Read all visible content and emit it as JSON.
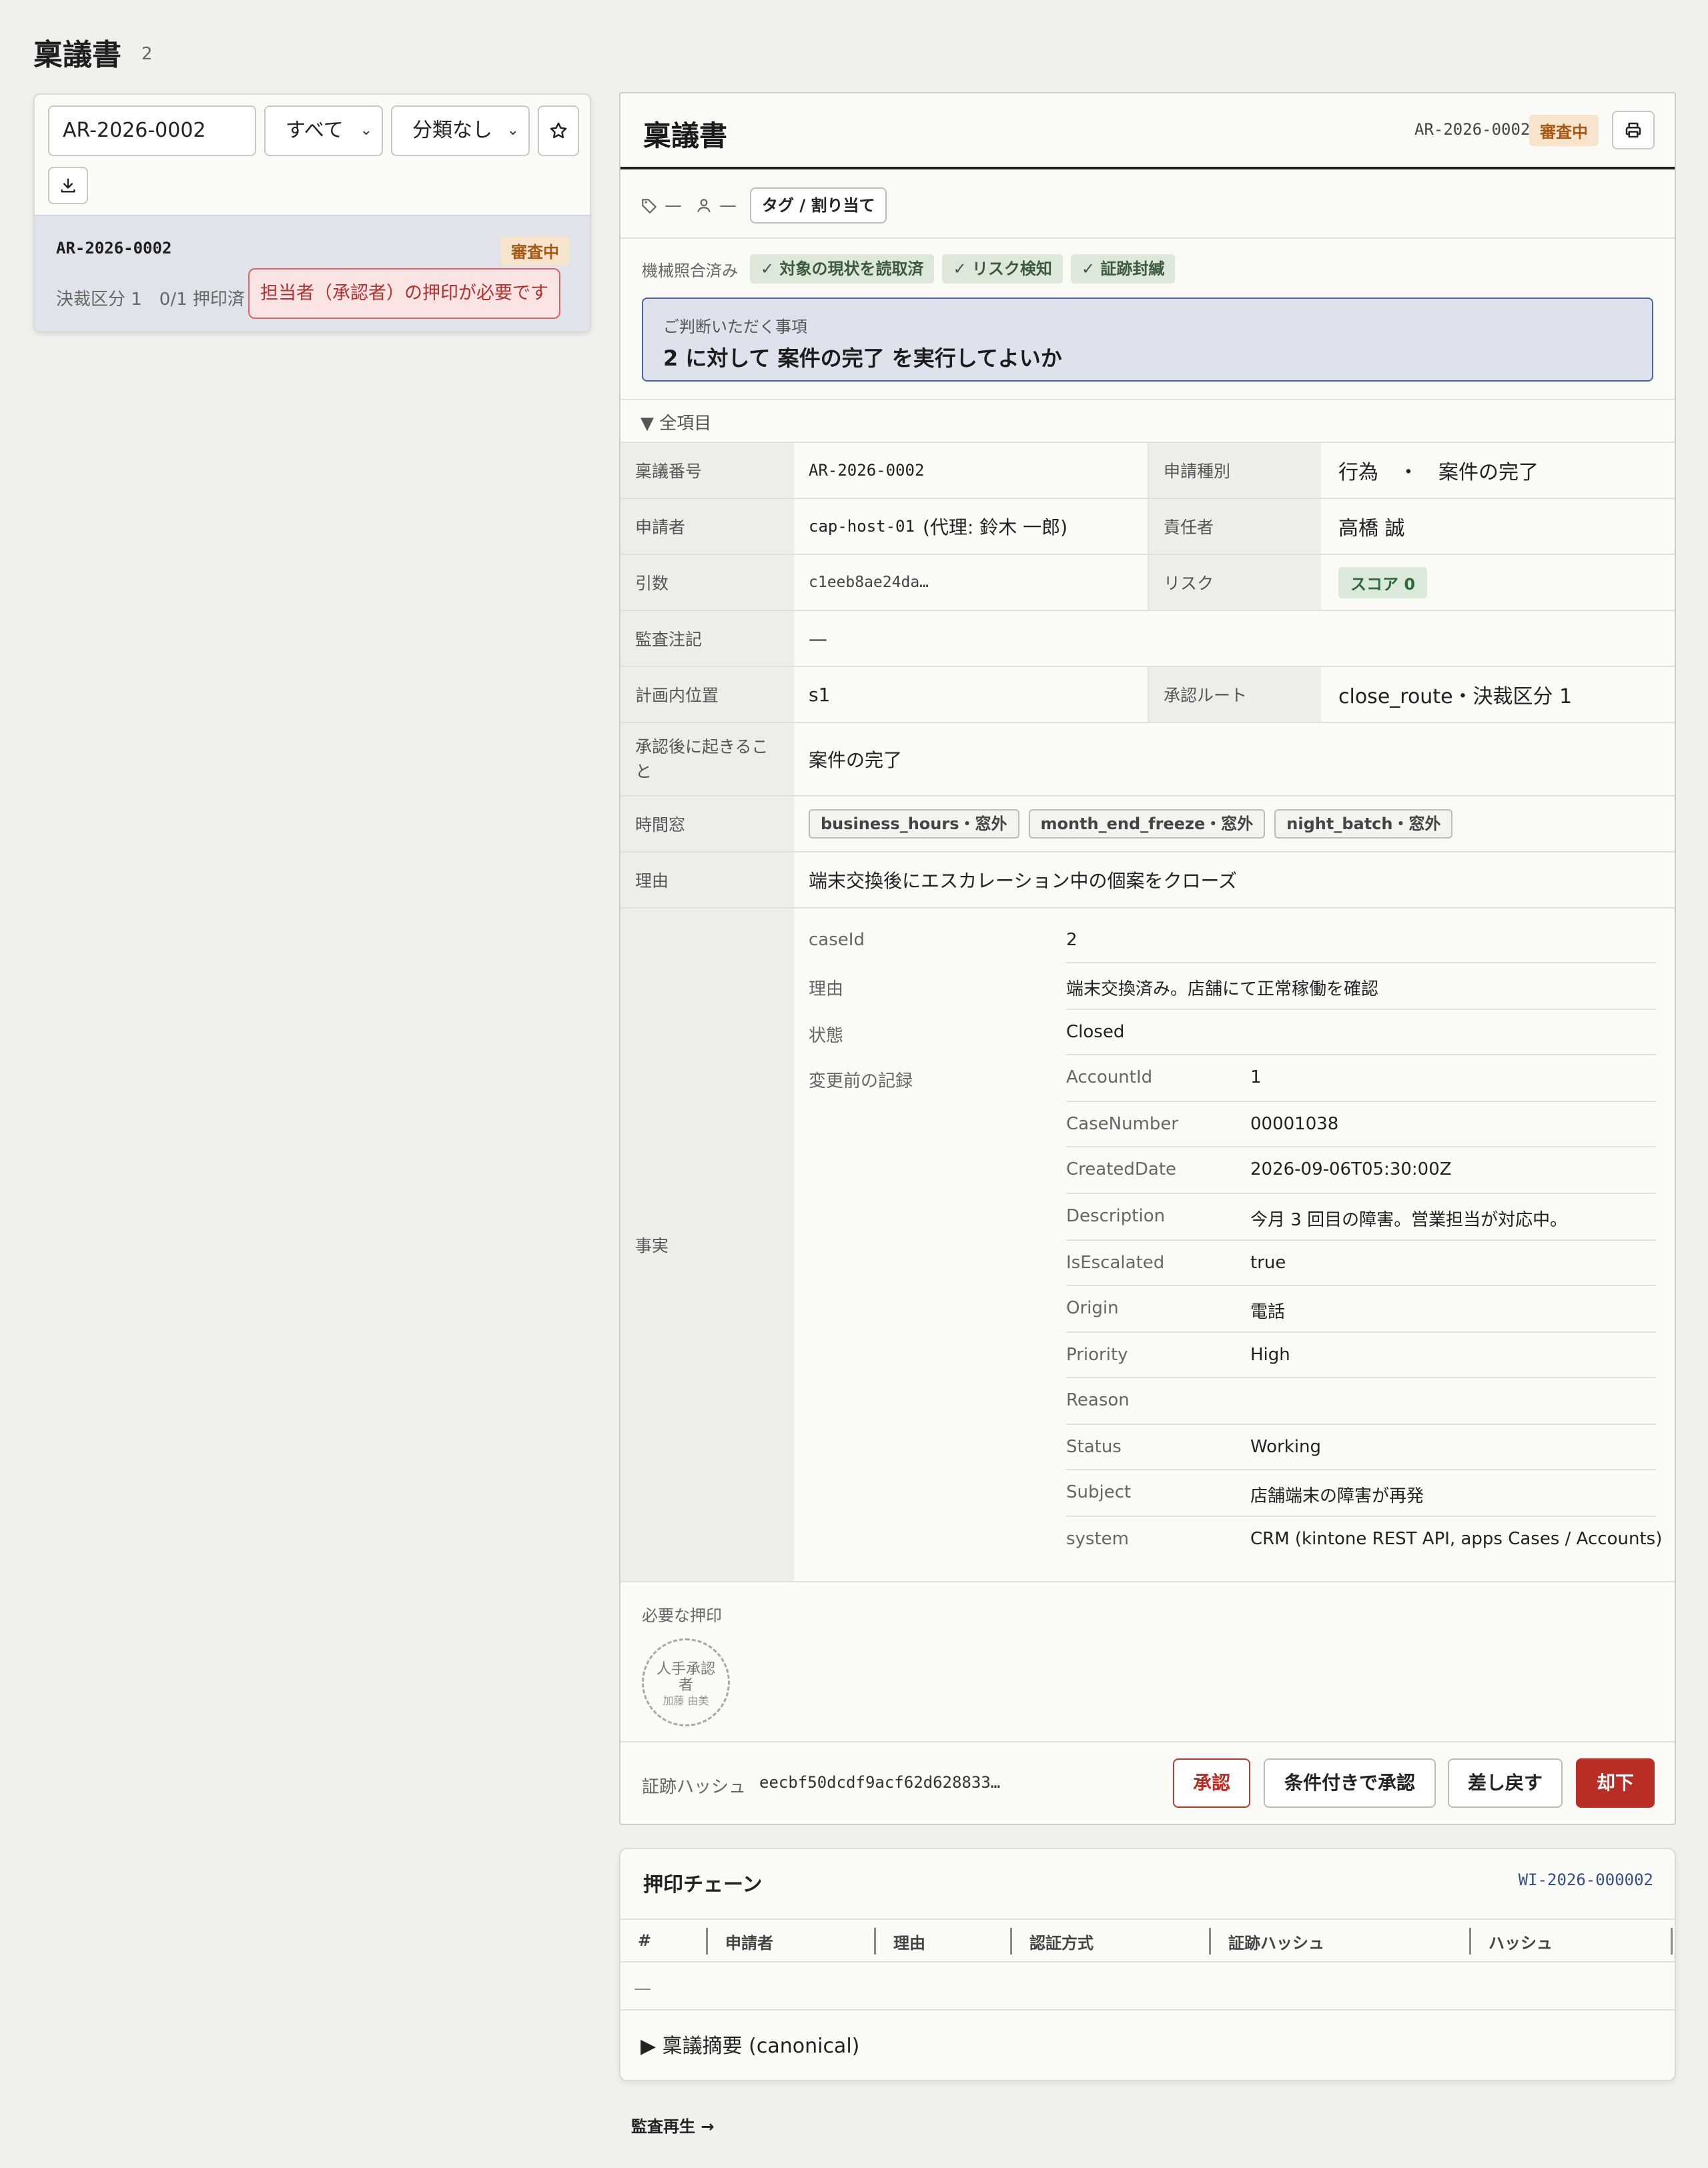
{
  "page": {
    "title": "稟議書",
    "count": "2"
  },
  "filters": {
    "search_value": "AR-2026-0002",
    "status_select": "すべて",
    "category_select": "分類なし"
  },
  "list_items": [
    {
      "id": "AR-2026-0002",
      "status": "審査中",
      "meta": "決裁区分 1　0/1 押印済",
      "alert": "担当者（承認者）の押印が必要です"
    }
  ],
  "detail": {
    "title": "稟議書",
    "id": "AR-2026-0002",
    "status": "審査中",
    "tags_label": "—",
    "assignee_label": "—",
    "tag_assign_button": "タグ / 割り当て",
    "verify_label": "機械照合済み",
    "verify_chips": [
      "対象の現状を読取済",
      "リスク検知",
      "証跡封緘"
    ],
    "decision_label": "ご判断いただく事項",
    "decision_text": "2 に対して 案件の完了 を実行してよいか",
    "all_items_toggle": "▼ 全項目",
    "rows": {
      "ringi_no_label": "稟議番号",
      "ringi_no": "AR-2026-0002",
      "req_type_label": "申請種別",
      "req_type": "行為　・　案件の完了",
      "applicant_label": "申請者",
      "applicant_id": "cap-host-01",
      "applicant_proxy": "(代理: 鈴木 一郎)",
      "owner_label": "責任者",
      "owner": "高橋 誠",
      "args_label": "引数",
      "args": "c1eeb8ae24da…",
      "risk_label": "リスク",
      "risk": "スコア 0",
      "audit_label": "監査注記",
      "audit": "—",
      "plan_pos_label": "計画内位置",
      "plan_pos": "s1",
      "route_label": "承認ルート",
      "route": "close_route・決裁区分 1",
      "after_label": "承認後に起きること",
      "after": "案件の完了",
      "window_label": "時間窓",
      "windows": [
        "business_hours・窓外",
        "month_end_freeze・窓外",
        "night_batch・窓外"
      ],
      "reason_label": "理由",
      "reason": "端末交換後にエスカレーション中の個案をクローズ",
      "facts_label": "事実"
    },
    "facts": {
      "caseId_key": "caseId",
      "caseId": "2",
      "reason_key": "理由",
      "reason": "端末交換済み。店舗にて正常稼働を確認",
      "state_key": "状態",
      "state": "Closed",
      "before_key": "変更前の記録",
      "before": [
        {
          "k": "AccountId",
          "v": "1"
        },
        {
          "k": "CaseNumber",
          "v": "00001038"
        },
        {
          "k": "CreatedDate",
          "v": "2026-09-06T05:30:00Z"
        },
        {
          "k": "Description",
          "v": "今月 3 回目の障害。営業担当が対応中。"
        },
        {
          "k": "IsEscalated",
          "v": "true"
        },
        {
          "k": "Origin",
          "v": "電話"
        },
        {
          "k": "Priority",
          "v": "High"
        },
        {
          "k": "Reason",
          "v": ""
        },
        {
          "k": "Status",
          "v": "Working"
        },
        {
          "k": "Subject",
          "v": "店舗端末の障害が再発"
        },
        {
          "k": "system",
          "v": "CRM (kintone REST API, apps Cases / Accounts)"
        }
      ]
    },
    "stamps_label": "必要な押印",
    "stamp": {
      "line1": "人手承認",
      "line2": "者",
      "name": "加藤 由美"
    },
    "hash_label": "証跡ハッシュ",
    "hash_value": "eecbf50dcdf9acf62d628833…",
    "actions": {
      "approve": "承認",
      "approve_cond": "条件付きで承認",
      "return": "差し戻す",
      "reject": "却下"
    }
  },
  "chain": {
    "title": "押印チェーン",
    "id": "WI-2026-000002",
    "columns": [
      "#",
      "申請者",
      "理由",
      "認証方式",
      "証跡ハッシュ",
      "ハッシュ"
    ],
    "empty": "—",
    "summary": "▶ 稟議摘要 (canonical)"
  },
  "replay_link": "監査再生 →",
  "colors": {
    "accent_red": "#b92d25",
    "badge_bg": "#f7e4cc",
    "badge_fg": "#a45a16",
    "decision_border": "#4d66a0"
  }
}
